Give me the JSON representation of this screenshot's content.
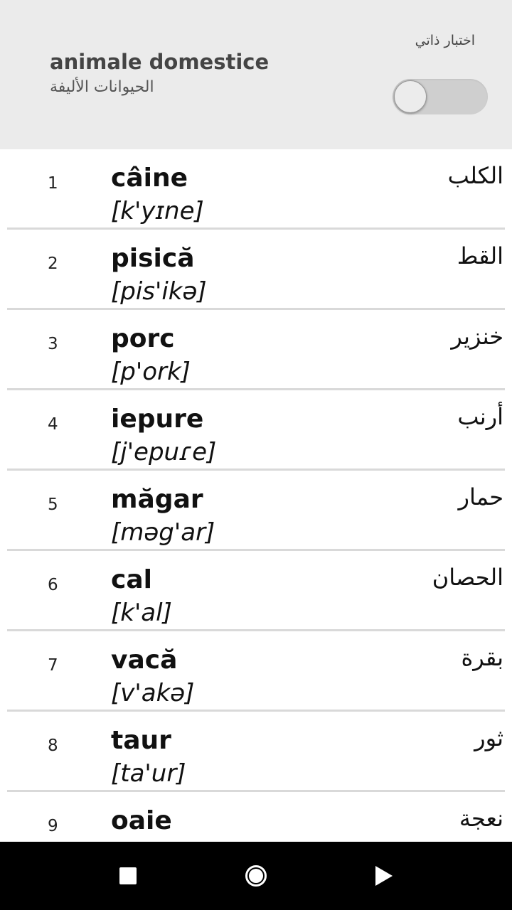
{
  "header": {
    "title": "animale domestice",
    "subtitle": "الحيوانات الأليفة",
    "quiz_label": "اختبار ذاتي",
    "quiz_toggle_on": false
  },
  "list": {
    "items": [
      {
        "num": "1",
        "word": "câine",
        "ipa": "[k'yɪne]",
        "translation": "الكلب"
      },
      {
        "num": "2",
        "word": "pisică",
        "ipa": "[pis'ikə]",
        "translation": "القط"
      },
      {
        "num": "3",
        "word": "porc",
        "ipa": "[p'ork]",
        "translation": "خنزير"
      },
      {
        "num": "4",
        "word": "iepure",
        "ipa": "[j'epuɾe]",
        "translation": "أرنب"
      },
      {
        "num": "5",
        "word": "măgar",
        "ipa": "[məg'ar]",
        "translation": "حمار"
      },
      {
        "num": "6",
        "word": "cal",
        "ipa": "[k'al]",
        "translation": "الحصان"
      },
      {
        "num": "7",
        "word": "vacă",
        "ipa": "[v'akə]",
        "translation": "بقرة"
      },
      {
        "num": "8",
        "word": "taur",
        "ipa": "[ta'ur]",
        "translation": "ثور"
      },
      {
        "num": "9",
        "word": "oaie",
        "ipa": "",
        "translation": "نعجة"
      }
    ]
  },
  "navbar": {
    "recents_icon": "square-icon",
    "home_icon": "circle-icon",
    "back_icon": "triangle-icon"
  },
  "colors": {
    "header_bg": "#ebebeb",
    "navbar_bg": "#000000",
    "divider": "#d9d9d9"
  }
}
